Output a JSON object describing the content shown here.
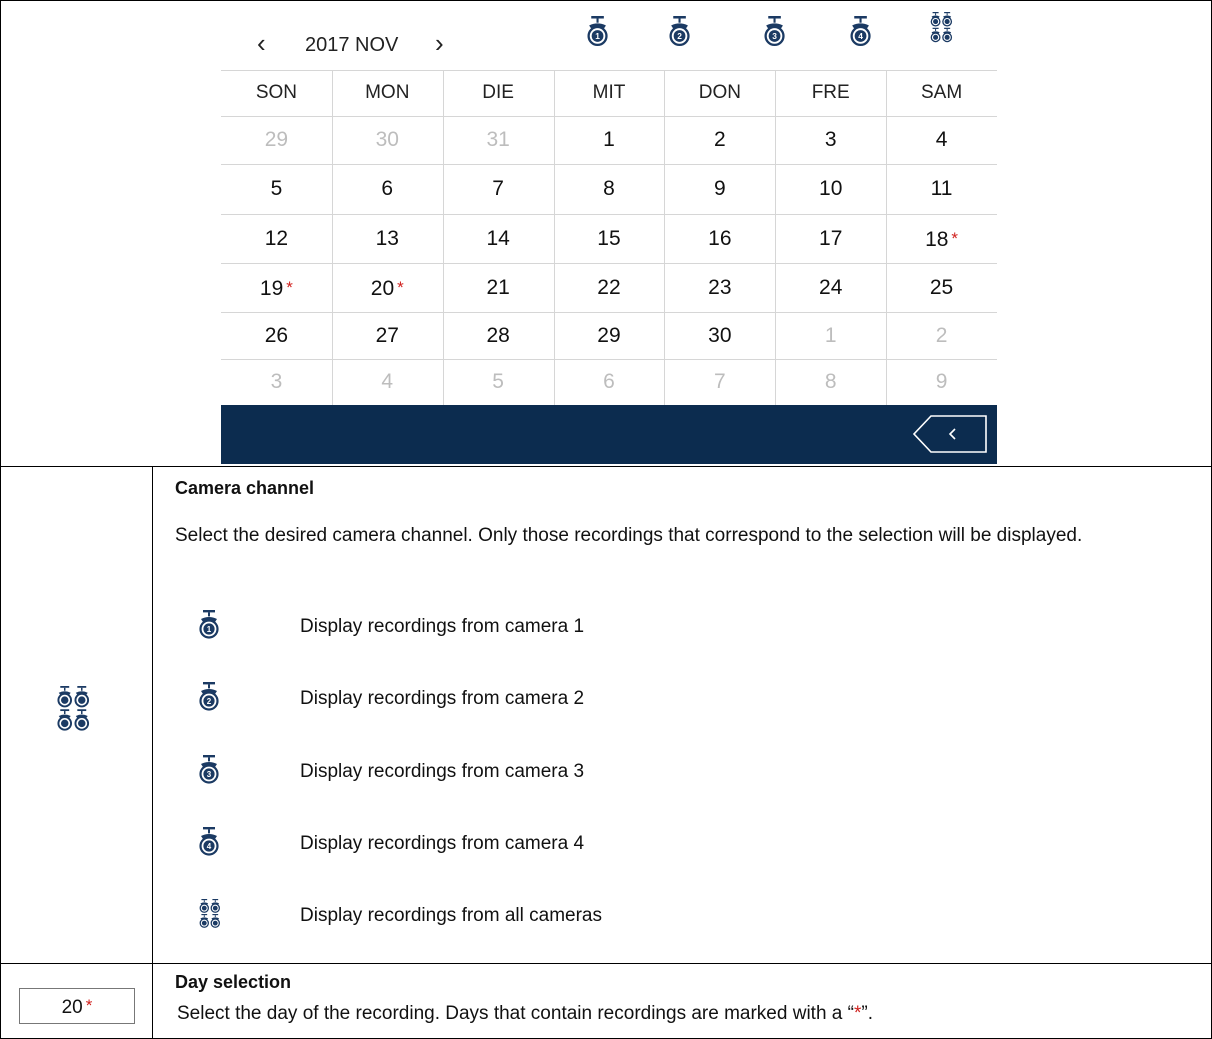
{
  "calendar": {
    "month_label": "2017 NOV",
    "prev_symbol": "‹",
    "next_symbol": "›",
    "camera_icons": [
      "camera-1-icon",
      "camera-2-icon",
      "camera-3-icon",
      "camera-4-icon",
      "all-cameras-icon"
    ],
    "weekdays": [
      "SON",
      "MON",
      "DIE",
      "MIT",
      "DON",
      "FRE",
      "SAM"
    ],
    "weeks": [
      [
        {
          "d": "29",
          "muted": true
        },
        {
          "d": "30",
          "muted": true
        },
        {
          "d": "31",
          "muted": true
        },
        {
          "d": "1"
        },
        {
          "d": "2"
        },
        {
          "d": "3"
        },
        {
          "d": "4"
        }
      ],
      [
        {
          "d": "5"
        },
        {
          "d": "6"
        },
        {
          "d": "7"
        },
        {
          "d": "8"
        },
        {
          "d": "9"
        },
        {
          "d": "10"
        },
        {
          "d": "11"
        }
      ],
      [
        {
          "d": "12"
        },
        {
          "d": "13"
        },
        {
          "d": "14"
        },
        {
          "d": "15"
        },
        {
          "d": "16"
        },
        {
          "d": "17"
        },
        {
          "d": "18",
          "star": true
        }
      ],
      [
        {
          "d": "19",
          "star": true
        },
        {
          "d": "20",
          "star": true
        },
        {
          "d": "21"
        },
        {
          "d": "22"
        },
        {
          "d": "23"
        },
        {
          "d": "24"
        },
        {
          "d": "25"
        }
      ],
      [
        {
          "d": "26"
        },
        {
          "d": "27"
        },
        {
          "d": "28"
        },
        {
          "d": "29"
        },
        {
          "d": "30"
        },
        {
          "d": "1",
          "muted": true
        },
        {
          "d": "2",
          "muted": true
        }
      ],
      [
        {
          "d": "3",
          "muted": true
        },
        {
          "d": "4",
          "muted": true
        },
        {
          "d": "5",
          "muted": true
        },
        {
          "d": "6",
          "muted": true
        },
        {
          "d": "7",
          "muted": true
        },
        {
          "d": "8",
          "muted": true
        },
        {
          "d": "9",
          "muted": true
        }
      ]
    ],
    "star_symbol": "*",
    "back_icon": "back-arrow-icon"
  },
  "camera_section": {
    "title": "Camera channel",
    "description": "Select the desired camera channel. Only those recordings that correspond to the selection will be displayed.",
    "items": [
      {
        "icon": "camera-1-icon",
        "text": "Display recordings from camera 1"
      },
      {
        "icon": "camera-2-icon",
        "text": "Display recordings from camera 2"
      },
      {
        "icon": "camera-3-icon",
        "text": "Display recordings from camera 3"
      },
      {
        "icon": "camera-4-icon",
        "text": "Display recordings from camera 4"
      },
      {
        "icon": "all-cameras-icon",
        "text": "Display recordings from all cameras"
      }
    ]
  },
  "day_section": {
    "title": "Day selection",
    "sample_day": "20",
    "sample_star": "*",
    "description_before": "Select the day of the recording. Days that contain recordings are marked with a “",
    "description_star": "*",
    "description_after": "”."
  },
  "colors": {
    "footer_bar": "#0c2c4f",
    "icon_blue": "#1b3a63",
    "star_red": "#d0201d",
    "muted_day": "#bdbdbd"
  }
}
